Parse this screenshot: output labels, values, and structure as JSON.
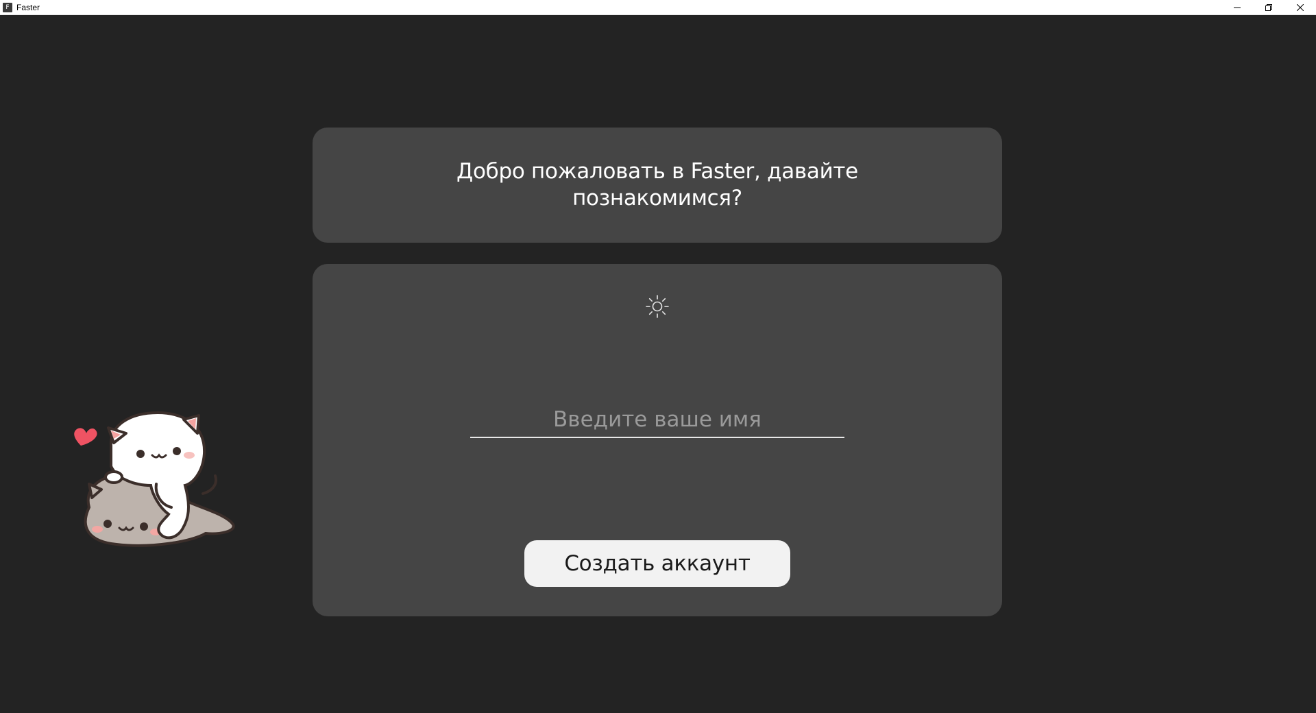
{
  "window": {
    "title": "Faster",
    "icon_letter": "F",
    "controls": [
      "minimize-icon",
      "restore-icon",
      "close-icon"
    ]
  },
  "welcome": {
    "text": "Добро пожаловать в Faster, давайте познакомимся?"
  },
  "form": {
    "theme_icon": "sun-icon",
    "name_input": {
      "value": "",
      "placeholder": "Введите ваше имя"
    },
    "create_button_label": "Создать аккаунт"
  },
  "mascot": {
    "icon": "cats-illustration-icon"
  },
  "colors": {
    "background": "#232323",
    "panel": "#454545",
    "button": "#f2f2f2",
    "text": "#ffffff",
    "placeholder": "#9a9a9a",
    "heart": "#ef5363"
  }
}
